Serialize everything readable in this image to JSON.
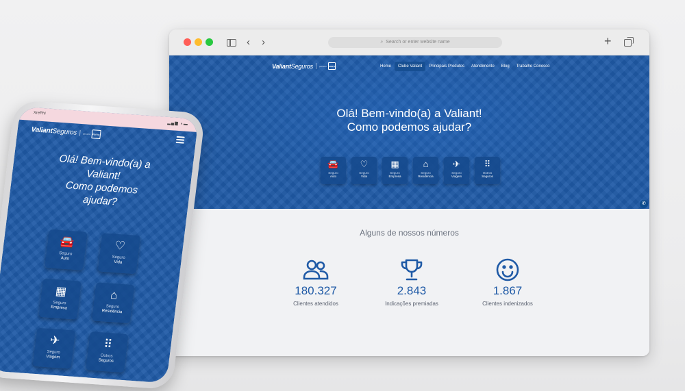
{
  "browser": {
    "address_placeholder": "Search or enter website name",
    "search_icon": "magnifier-icon",
    "plus_icon": "+",
    "back_icon": "‹",
    "forward_icon": "›"
  },
  "site": {
    "brand_bold": "Valiant",
    "brand_light": "Seguros",
    "partner_label": "parceiro",
    "partner_badge": "PORTO",
    "nav": [
      "Home",
      "Clube Valiant",
      "Principais Produtos",
      "Atendimento",
      "Blog",
      "Trabalhe Conosco"
    ],
    "hero_line1": "Olá! Bem-vindo(a) a Valiant!",
    "hero_line2": "Como podemos ajudar?",
    "tiles": [
      {
        "icon": "car-icon",
        "glyph": "🚘",
        "l1": "Seguro",
        "l2": "Auto"
      },
      {
        "icon": "heart-icon",
        "glyph": "♡",
        "l1": "Seguro",
        "l2": "Vida"
      },
      {
        "icon": "building-icon",
        "glyph": "▦",
        "l1": "Seguro",
        "l2": "Empresa"
      },
      {
        "icon": "house-icon",
        "glyph": "⌂",
        "l1": "Seguro",
        "l2": "Residência"
      },
      {
        "icon": "airplane-icon",
        "glyph": "✈",
        "l1": "Seguro",
        "l2": "Viagem"
      },
      {
        "icon": "grid-dots-icon",
        "glyph": "⠿",
        "l1": "Outros",
        "l2": "Seguros"
      }
    ],
    "whatsapp_icon": "whatsapp-icon",
    "numbers_title": "Alguns de nossos números",
    "stats": [
      {
        "icon": "users-icon",
        "value": "180.327",
        "label": "Clientes atendidos"
      },
      {
        "icon": "trophy-icon",
        "value": "2.843",
        "label": "Indicações premiadas"
      },
      {
        "icon": "smile-icon",
        "value": "1.867",
        "label": "Clientes indenizados"
      }
    ]
  },
  "phone": {
    "carrier": "XrePhi",
    "status_icons": "▂▄▆ ◖▬",
    "title_lines": [
      "Olá! Bem-vindo(a) a",
      "Valiant!",
      "Como podemos",
      "ajudar?"
    ],
    "tiles": [
      {
        "icon": "car-icon",
        "glyph": "🚘",
        "l1": "Seguro",
        "l2": "Auto"
      },
      {
        "icon": "heart-icon",
        "glyph": "♡",
        "l1": "Seguro",
        "l2": "Vida"
      },
      {
        "icon": "building-icon",
        "glyph": "▦",
        "l1": "Seguro",
        "l2": "Empresa"
      },
      {
        "icon": "house-icon",
        "glyph": "⌂",
        "l1": "Seguro",
        "l2": "Residência"
      },
      {
        "icon": "airplane-icon",
        "glyph": "✈",
        "l1": "Seguro",
        "l2": "Viagem"
      },
      {
        "icon": "grid-dots-icon",
        "glyph": "⠿",
        "l1": "Outros",
        "l2": "Seguros"
      }
    ]
  },
  "colors": {
    "brand_blue": "#1f5aa6",
    "tile_blue": "#15498c",
    "stat_blue": "#1f5aa6",
    "traffic_red": "#ff5e57",
    "traffic_yellow": "#febc2e",
    "traffic_green": "#28c840"
  }
}
